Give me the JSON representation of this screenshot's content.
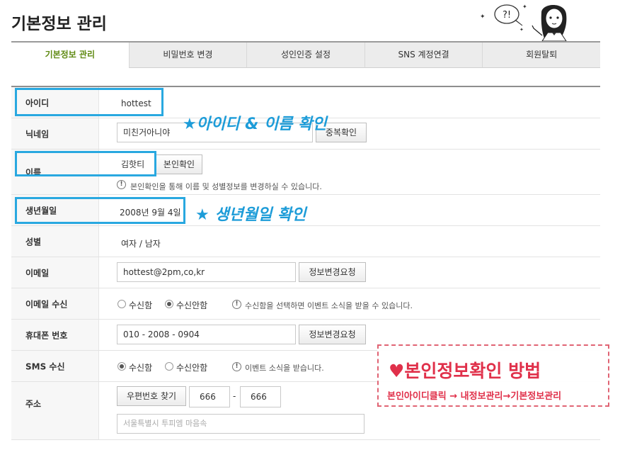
{
  "page": {
    "title": "기본정보 관리"
  },
  "tabs": [
    {
      "label": "기본정보 관리",
      "active": true
    },
    {
      "label": "비밀번호 변경",
      "active": false
    },
    {
      "label": "성인인증 설정",
      "active": false
    },
    {
      "label": "SNS 계정연결",
      "active": false
    },
    {
      "label": "회원탈퇴",
      "active": false
    }
  ],
  "form": {
    "id": {
      "label": "아이디",
      "value": "hottest"
    },
    "nickname": {
      "label": "닉네임",
      "value": "미친거아니야",
      "button": "중복확인"
    },
    "name": {
      "label": "이름",
      "value": "김핫티",
      "button": "본인확인",
      "notice": "본인확인을 통해 이름 및 성별정보를 변경하실 수 있습니다."
    },
    "birth": {
      "label": "생년월일",
      "value": "2008년 9월 4일"
    },
    "gender": {
      "label": "성별",
      "value": "여자 / 남자"
    },
    "email": {
      "label": "이메일",
      "value": "hottest@2pm,co,kr",
      "button": "정보변경요청"
    },
    "email_receive": {
      "label": "이메일 수신",
      "opt_yes": "수신함",
      "opt_no": "수신안함",
      "selected": "수신안함",
      "notice": "수신함을 선택하면 이벤트 소식을 받을 수 있습니다."
    },
    "phone": {
      "label": "휴대폰 번호",
      "value": "010 - 2008 - 0904",
      "button": "정보변경요청"
    },
    "sms_receive": {
      "label": "SMS 수신",
      "opt_yes": "수신함",
      "opt_no": "수신안함",
      "selected": "수신함",
      "notice": "이벤트 소식을 받습니다."
    },
    "address": {
      "label": "주소",
      "button": "우편번호 찾기",
      "zip1": "666",
      "dash": "-",
      "zip2": "666",
      "detail_placeholder": "서울특별시 투피엠 마음속"
    }
  },
  "annotations": {
    "id_name": "★아이디 & 이름 확인",
    "birth": "★ 생년월일 확인",
    "guide_title": "본인정보확인 방법",
    "guide_heart": "♥",
    "guide_steps": "본인아이디클릭 → 내정보관리→기본정보관리",
    "highlight_color": "#29a8e0",
    "guide_color": "#e0304a"
  },
  "cartoon": {
    "speech": "?!"
  }
}
